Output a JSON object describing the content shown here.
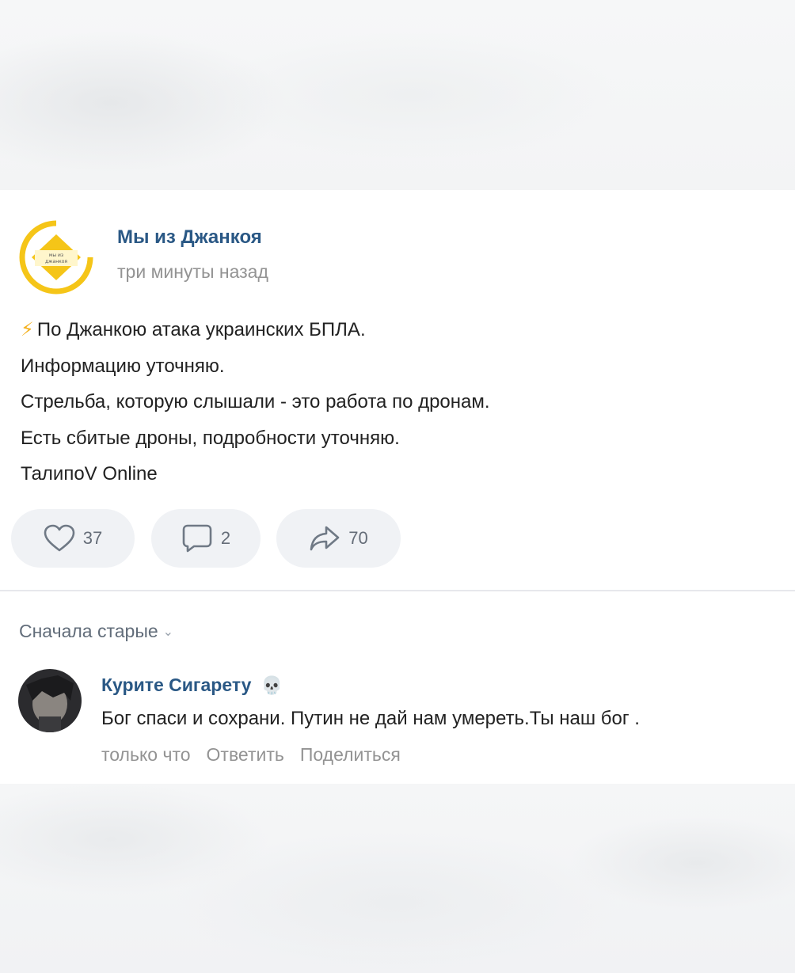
{
  "post": {
    "author": "Мы из Джанкоя",
    "time": "три минуты назад",
    "lines": [
      "По Джанкою атака украинских БПЛА.",
      "Информацию уточняю.",
      "Стрельба, которую слышали - это работа по дронам.",
      "Есть сбитые дроны, подробности уточняю.",
      "ТалипоV Online"
    ],
    "lead_emoji": "⚡",
    "logo_text": [
      "мы из",
      "джанкоя"
    ],
    "actions": {
      "likes": "37",
      "comments": "2",
      "shares": "70"
    }
  },
  "comments": {
    "sort_label": "Сначала старые",
    "items": [
      {
        "author": "Курите Сигарету",
        "author_emoji": "💀",
        "text": "Бог спаси и сохрани. Путин не дай нам умереть.Ты наш бог .",
        "time": "только что",
        "reply": "Ответить",
        "share": "Поделиться"
      }
    ]
  },
  "colors": {
    "link_blue": "#2a5885",
    "muted": "#939393",
    "pill_bg": "#f0f2f5",
    "logo_yellow": "#f5c518"
  },
  "icons": [
    "heart-icon",
    "comment-icon",
    "share-icon",
    "chevron-down-icon",
    "skull-icon",
    "lightning-icon"
  ]
}
